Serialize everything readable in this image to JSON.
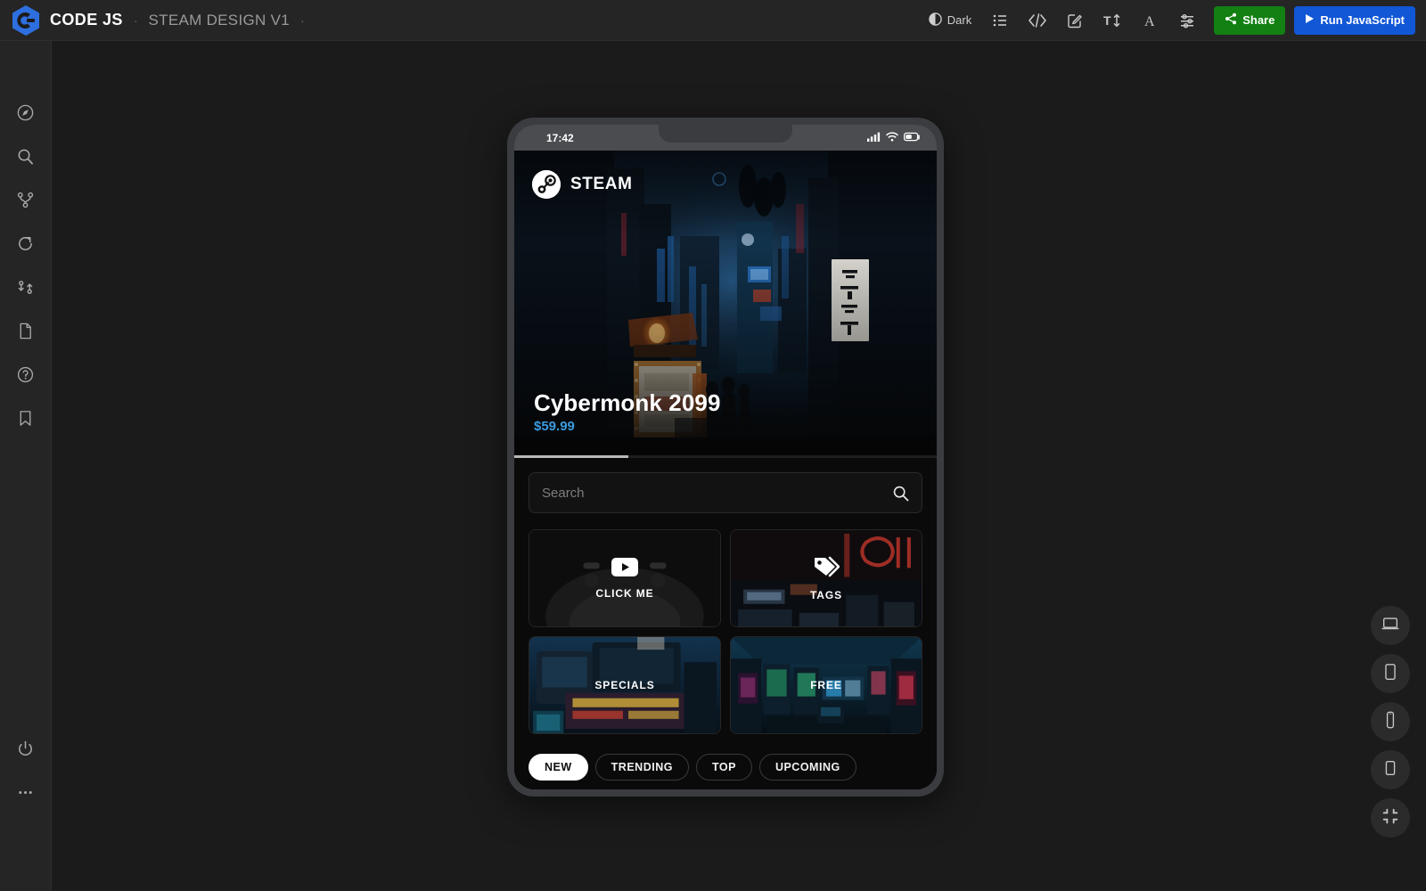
{
  "app": {
    "brand": "CODE JS",
    "separator": "·",
    "project": "STEAM DESIGN V1",
    "separator2": "·"
  },
  "toolbar": {
    "theme_label": "Dark",
    "theme_icon": "half-circle-icon",
    "icons": [
      {
        "name": "list-icon",
        "label": "List"
      },
      {
        "name": "code-icon",
        "label": "Code"
      },
      {
        "name": "edit-icon",
        "label": "Edit"
      },
      {
        "name": "text-size-icon",
        "label": "Text Size"
      },
      {
        "name": "font-icon",
        "label": "Font"
      },
      {
        "name": "settings-sliders-icon",
        "label": "Settings"
      }
    ],
    "share_label": "Share",
    "run_label": "Run JavaScript",
    "share_color": "#128012",
    "run_color": "#1157d6"
  },
  "sidebar": {
    "items": [
      {
        "name": "compass-icon",
        "label": "Explore"
      },
      {
        "name": "search-icon",
        "label": "Search"
      },
      {
        "name": "git-branch-icon",
        "label": "Branches"
      },
      {
        "name": "refresh-icon",
        "label": "Refresh"
      },
      {
        "name": "sync-icon",
        "label": "Sync"
      },
      {
        "name": "file-icon",
        "label": "File"
      },
      {
        "name": "help-circle-icon",
        "label": "Help"
      },
      {
        "name": "bookmark-icon",
        "label": "Bookmark"
      }
    ],
    "bottom": [
      {
        "name": "power-icon",
        "label": "Power"
      },
      {
        "name": "more-icon",
        "label": "More"
      }
    ]
  },
  "devices": [
    {
      "name": "device-laptop-icon",
      "label": "Laptop"
    },
    {
      "name": "device-tablet-icon",
      "label": "Tablet"
    },
    {
      "name": "device-phone-icon",
      "label": "Phone"
    },
    {
      "name": "device-tablet-small-icon",
      "label": "Small Tablet"
    },
    {
      "name": "fullscreen-exit-icon",
      "label": "Collapse"
    }
  ],
  "preview": {
    "statusbar": {
      "time": "17:42",
      "signal_icon": "cellular-icon",
      "wifi_icon": "wifi-icon",
      "battery_icon": "battery-icon"
    },
    "hero": {
      "brand": "STEAM",
      "brand_icon": "steam-logo-icon",
      "title": "Cybermonk 2099",
      "price": "$59.99",
      "price_color": "#3b9cdd"
    },
    "progress": {
      "value": "27"
    },
    "search": {
      "placeholder": "Search",
      "value": "",
      "icon": "search-icon"
    },
    "cards": [
      {
        "label": "CLICK ME",
        "icon": "play-button-icon",
        "art": "controller"
      },
      {
        "label": "TAGS",
        "icon": "tags-icon",
        "art": "neon-sign"
      },
      {
        "label": "SPECIALS",
        "icon": "",
        "art": "arcade-blue"
      },
      {
        "label": "FREE",
        "icon": "",
        "art": "arcade-room"
      }
    ],
    "tabs": [
      {
        "label": "NEW",
        "active": true
      },
      {
        "label": "TRENDING",
        "active": false
      },
      {
        "label": "TOP",
        "active": false
      },
      {
        "label": "UPCOMING",
        "active": false
      }
    ]
  }
}
